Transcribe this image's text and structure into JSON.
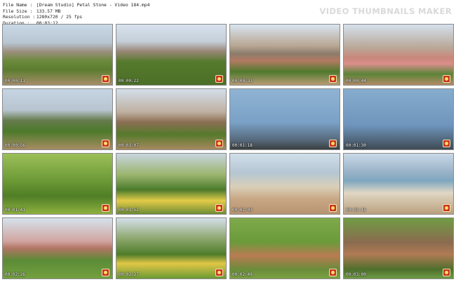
{
  "header": {
    "rows": [
      {
        "label": "File Name :",
        "value": "[Dream Studio] Petal Stone - Video 184.mp4"
      },
      {
        "label": "File Size :",
        "value": "133.57 MB"
      },
      {
        "label": "Resolution :",
        "value": "1280x720 / 25 fps"
      },
      {
        "label": "Duration :",
        "value": "00:03:12"
      }
    ],
    "watermark": "VIDEO THUMBNAILS MAKER"
  },
  "thumbnails": [
    {
      "timestamp": "00:00:11",
      "scene": "palm-swing-wide"
    },
    {
      "timestamp": "00:00:22",
      "scene": "palm-swing-red"
    },
    {
      "timestamp": "00:00:33",
      "scene": "swing-legs-up"
    },
    {
      "timestamp": "00:00:44",
      "scene": "swing-villa"
    },
    {
      "timestamp": "00:00:56",
      "scene": "frame-swing-wide"
    },
    {
      "timestamp": "00:01:07",
      "scene": "frame-swing-yellow"
    },
    {
      "timestamp": "00:01:18",
      "scene": "sky-silhouette"
    },
    {
      "timestamp": "00:01:30",
      "scene": "sky-silhouette-2"
    },
    {
      "timestamp": "00:01:41",
      "scene": "hammock-rainbow"
    },
    {
      "timestamp": "00:01:52",
      "scene": "closeup-yellow"
    },
    {
      "timestamp": "00:02:03",
      "scene": "beach-swing"
    },
    {
      "timestamp": "00:02:15",
      "scene": "sea-swing"
    },
    {
      "timestamp": "00:02:26",
      "scene": "garden-swing"
    },
    {
      "timestamp": "00:02:37",
      "scene": "yellow-swing-palms"
    },
    {
      "timestamp": "00:02:49",
      "scene": "bench-girls"
    },
    {
      "timestamp": "00:03:00",
      "scene": "bench-girls-close"
    }
  ],
  "colors": {
    "text": "#222222",
    "watermark": "#d9d9d9",
    "timestamp": "#ffffff"
  }
}
